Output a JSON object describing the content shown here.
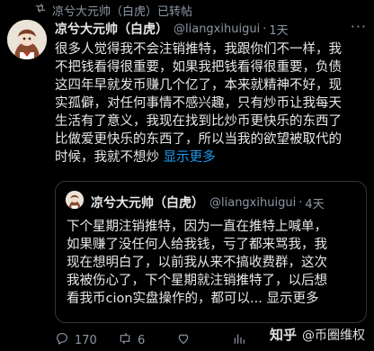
{
  "repost": {
    "label": "凉兮大元帅（白虎）已转帖"
  },
  "post": {
    "name": "凉兮大元帅（白虎）",
    "handle": "@liangxihuigui",
    "separator": "·",
    "time": "1天",
    "more": "···",
    "lines": [
      "很多人觉得我不会注销推特，我跟你们不一样，我",
      "不把钱看得很重要，如果我把钱看得很重要，负债",
      "这四年早就发币赚几个亿了，本来就精神不好，现",
      "实孤僻，对任何事情不感兴趣，只有炒币让我每天",
      "生活有了意义，我现在找到比炒币更快乐的东西了",
      "比做爱更快乐的东西了，所以当我的欲望被取代的",
      "时候，我就不想炒"
    ],
    "show_more": "显示更多"
  },
  "quote": {
    "name": "凉兮大元帅（白虎）",
    "handle": "@liangxihuigui",
    "separator": "·",
    "time": "4天",
    "lines": [
      "下个星期注销推特，因为一直在推特上喊单，",
      "如果赚了没任何人给我钱，亏了都来骂我，我",
      "现在想明白了，以前我从来不搞收费群，这次",
      "我被伤心了，下个星期就注销推特了，以后想",
      "看我币cion实盘操作的，都可以... 显示更多"
    ]
  },
  "actions": {
    "replies": "170",
    "reposts": "6",
    "likes": "",
    "views": ""
  },
  "watermark": {
    "logo": "知乎",
    "text": "@币圈维权"
  },
  "colors": {
    "background": "#000000",
    "text": "#e7e9ea",
    "muted": "#8b98a5",
    "accent": "#1d9bf0",
    "border": "#333639"
  }
}
